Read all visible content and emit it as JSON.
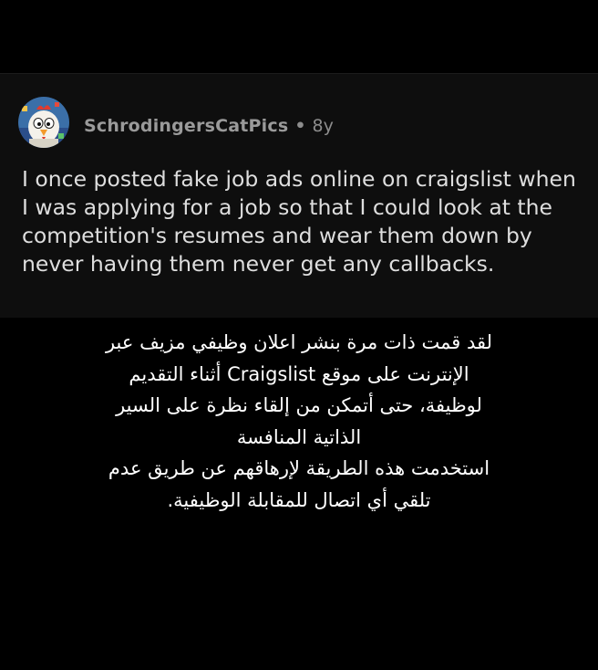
{
  "comment": {
    "username": "SchrodingersCatPics",
    "separator": "•",
    "age": "8y",
    "avatar_icon": "snoo-chicken-avatar-icon",
    "body": "I once posted fake job ads online on craigslist when I was applying for a job so that I could look at the competition's resumes and wear them down by never having them never get any callbacks."
  },
  "caption": {
    "lines": [
      "لقد قمت ذات مرة بنشر اعلان وظيفي مزيف عبر",
      "الإنترنت على موقع Craigslist أثناء التقديم",
      "لوظيفة، حتى أتمكن من إلقاء نظرة على السير",
      "الذاتية المنافسة",
      "استخدمت هذه الطريقة لإرهاقهم عن طريق عدم",
      "تلقي أي اتصال للمقابلة الوظيفية."
    ]
  },
  "colors": {
    "background": "#000000",
    "card": "#0e0e0e",
    "meta_text": "#8d8d8d",
    "body_text": "#dedede",
    "caption_text": "#ffffff"
  }
}
